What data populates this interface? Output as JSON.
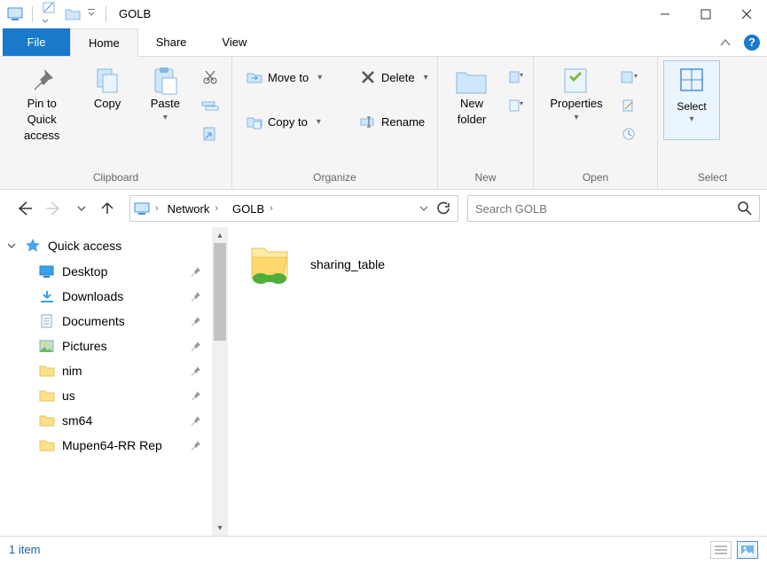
{
  "window": {
    "title": "GOLB"
  },
  "tabs": {
    "file": "File",
    "home": "Home",
    "share": "Share",
    "view": "View"
  },
  "ribbon": {
    "clipboard": {
      "label": "Clipboard",
      "pin": "Pin to Quick access",
      "copy": "Copy",
      "paste": "Paste"
    },
    "organize": {
      "label": "Organize",
      "moveto": "Move to",
      "copyto": "Copy to",
      "delete": "Delete",
      "rename": "Rename"
    },
    "new": {
      "label": "New",
      "newfolder": "New folder"
    },
    "open": {
      "label": "Open",
      "properties": "Properties"
    },
    "select": {
      "label": "Select",
      "select": "Select"
    }
  },
  "address": {
    "segments": [
      "Network",
      "GOLB"
    ],
    "search_placeholder": "Search GOLB"
  },
  "navpane": {
    "root": "Quick access",
    "items": [
      {
        "label": "Desktop",
        "icon": "desktop"
      },
      {
        "label": "Downloads",
        "icon": "downloads"
      },
      {
        "label": "Documents",
        "icon": "documents"
      },
      {
        "label": "Pictures",
        "icon": "pictures"
      },
      {
        "label": "nim",
        "icon": "folder"
      },
      {
        "label": "us",
        "icon": "folder"
      },
      {
        "label": "sm64",
        "icon": "folder"
      },
      {
        "label": "Mupen64-RR Rep",
        "icon": "folder"
      }
    ]
  },
  "content": {
    "items": [
      {
        "label": "sharing_table"
      }
    ]
  },
  "status": {
    "text": "1 item"
  }
}
